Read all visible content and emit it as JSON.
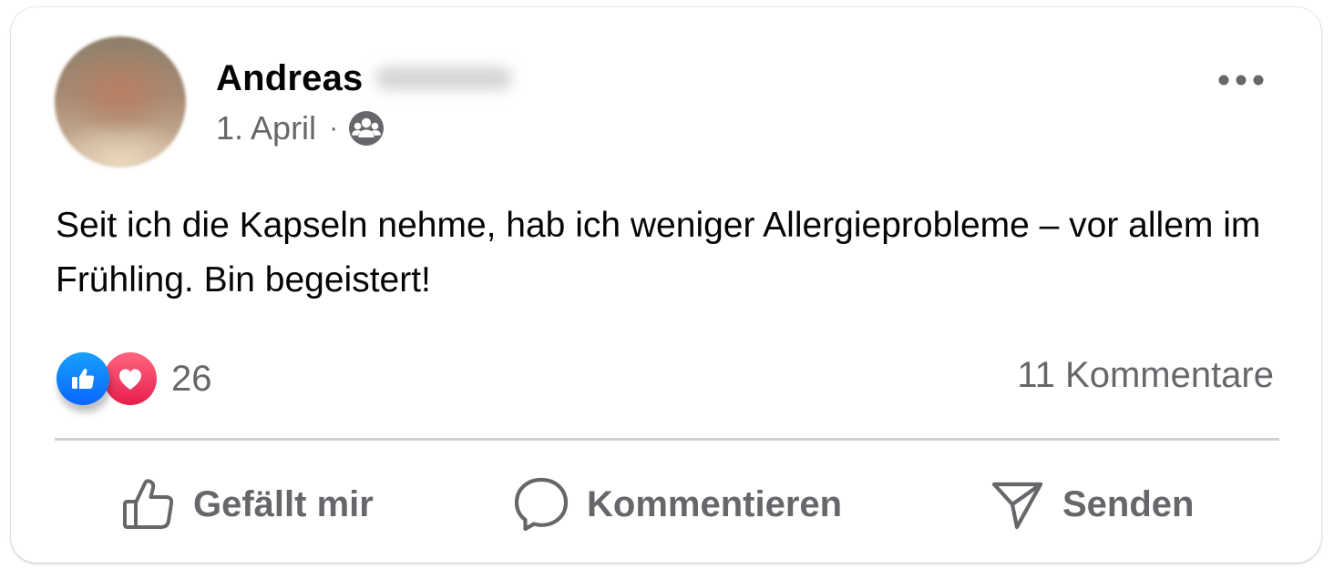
{
  "post": {
    "author_name": "Andreas",
    "date": "1. April",
    "separator": "·",
    "audience_icon": "group-icon",
    "text": "Seit ich die Kapseln nehme, hab ich weniger Allergieprobleme – vor allem im Frühling. Bin begeistert!",
    "more_icon": "more-options-icon"
  },
  "reactions": {
    "types": [
      "like",
      "love"
    ],
    "count": "26",
    "comments": "11 Kommentare",
    "like_color": "#0866ff",
    "love_color": "#f33e58"
  },
  "actions": {
    "like_label": "Gefällt mir",
    "comment_label": "Kommentieren",
    "send_label": "Senden"
  },
  "colors": {
    "text_primary": "#050505",
    "text_secondary": "#65676b",
    "divider": "#ced0d4",
    "background": "#ffffff"
  }
}
